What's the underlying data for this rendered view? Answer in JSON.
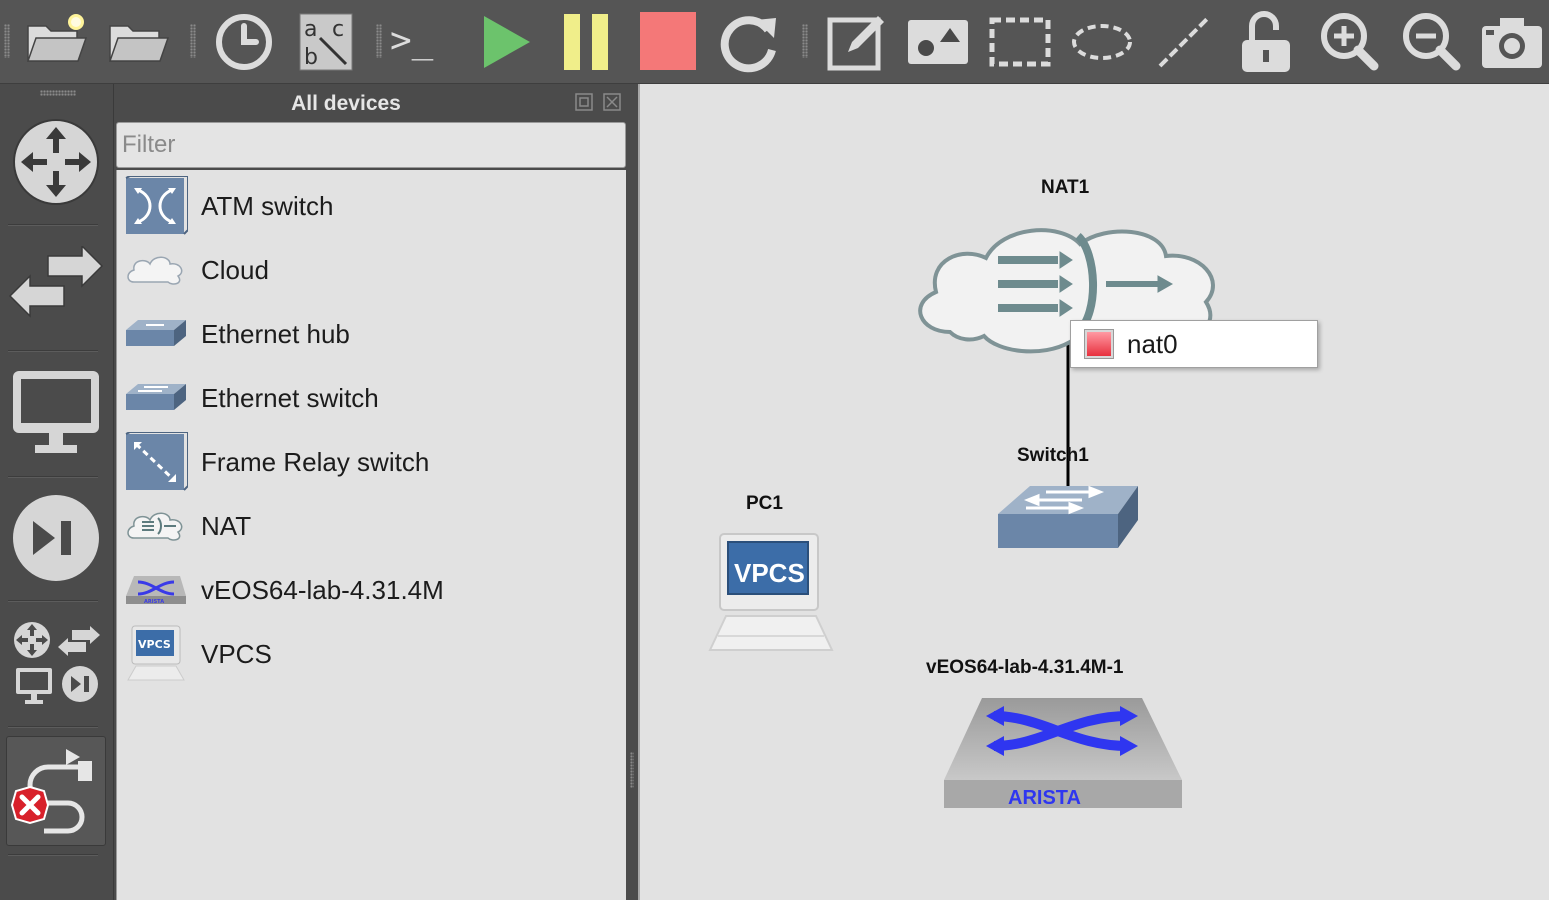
{
  "toolbar": {
    "buttons": [
      {
        "name": "new-project-icon"
      },
      {
        "name": "open-project-icon"
      },
      {
        "name": "snapshot-clock-icon"
      },
      {
        "name": "show-interface-labels-icon"
      },
      {
        "name": "console-all-icon"
      },
      {
        "name": "start-all-icon"
      },
      {
        "name": "suspend-all-icon"
      },
      {
        "name": "stop-all-icon"
      },
      {
        "name": "reload-all-icon"
      },
      {
        "name": "add-note-icon"
      },
      {
        "name": "insert-picture-icon"
      },
      {
        "name": "draw-rectangle-icon"
      },
      {
        "name": "draw-ellipse-icon"
      },
      {
        "name": "draw-line-icon"
      },
      {
        "name": "lock-unlock-icon"
      },
      {
        "name": "zoom-in-icon"
      },
      {
        "name": "zoom-out-icon"
      },
      {
        "name": "screenshot-camera-icon"
      }
    ],
    "colors": {
      "start": "#6cc36c",
      "suspend": "#f0ee8a",
      "stop": "#f47878"
    },
    "text_icon_glyph": ">_",
    "abc_letters": {
      "a": "a",
      "b": "b",
      "c": "c"
    }
  },
  "devices_panel": {
    "title": "All devices",
    "filter_placeholder": "Filter",
    "items": [
      {
        "label": "ATM switch",
        "icon": "atm-switch-icon"
      },
      {
        "label": "Cloud",
        "icon": "cloud-icon"
      },
      {
        "label": "Ethernet hub",
        "icon": "ethernet-hub-icon"
      },
      {
        "label": "Ethernet switch",
        "icon": "ethernet-switch-icon"
      },
      {
        "label": "Frame Relay switch",
        "icon": "frame-relay-switch-icon"
      },
      {
        "label": "NAT",
        "icon": "nat-icon"
      },
      {
        "label": "vEOS64-lab-4.31.4M",
        "icon": "arista-veos-icon"
      },
      {
        "label": "VPCS",
        "icon": "vpcs-icon"
      }
    ],
    "vpcs_icon_text": "VPCS",
    "arista_icon_text": "ARISTA"
  },
  "canvas": {
    "nodes": {
      "nat1": {
        "label": "NAT1"
      },
      "switch1": {
        "label": "Switch1"
      },
      "pc1": {
        "label": "PC1",
        "screen_text": "VPCS"
      },
      "veos": {
        "label": "vEOS64-lab-4.31.4M-1",
        "brand_text": "ARISTA"
      }
    },
    "tooltip": {
      "port": "nat0",
      "status_color": "#e8313f"
    }
  }
}
